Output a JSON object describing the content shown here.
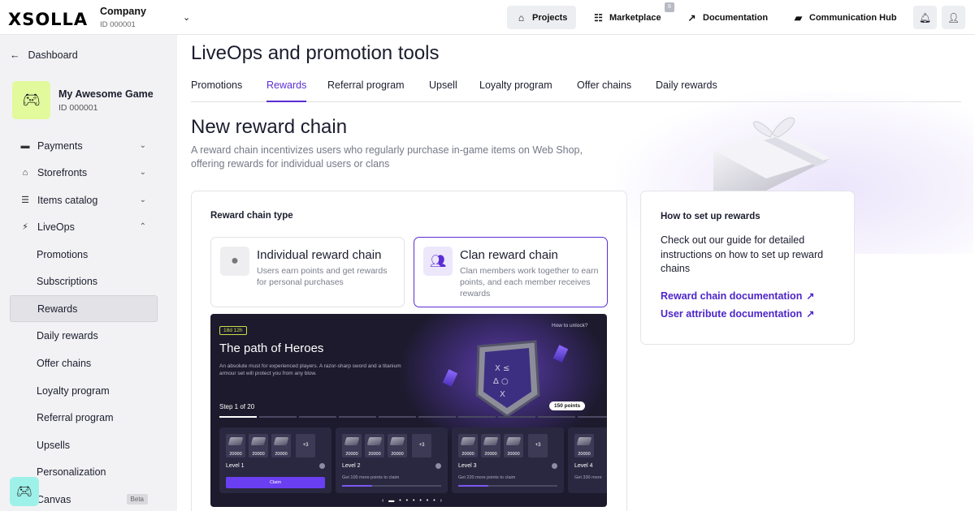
{
  "topbar": {
    "logo": "XSOLLA",
    "company_name": "Company",
    "company_id": "ID 000001",
    "nav": {
      "projects": "Projects",
      "marketplace": "Marketplace",
      "marketplace_badge": "8",
      "documentation": "Documentation",
      "communication_hub": "Communication Hub"
    }
  },
  "sidebar": {
    "back_label": "Dashboard",
    "game_name": "My Awesome Game",
    "game_id": "ID 000001",
    "groups": {
      "payments": "Payments",
      "storefronts": "Storefronts",
      "items_catalog": "Items catalog",
      "liveops": "LiveOps"
    },
    "liveops_items": {
      "promotions": "Promotions",
      "subscriptions": "Subscriptions",
      "rewards": "Rewards",
      "daily_rewards": "Daily rewards",
      "offer_chains": "Offer chains",
      "loyalty_program": "Loyalty program",
      "referral_program": "Referral program",
      "upsells": "Upsells",
      "personalization": "Personalization",
      "canvas": "Canvas"
    },
    "canvas_badge": "Beta",
    "active_item": "Rewards"
  },
  "main": {
    "page_title": "LiveOps and promotion tools",
    "tabs": {
      "promotions": "Promotions",
      "rewards": "Rewards",
      "referral_program": "Referral program",
      "upsell": "Upsell",
      "loyalty_program": "Loyalty program",
      "offer_chains": "Offer chains",
      "daily_rewards": "Daily rewards"
    },
    "active_tab": "Rewards",
    "section_title": "New reward chain",
    "section_desc": "A reward chain incentivizes users who regularly purchase in-game items on Web Shop, offering rewards for individual users or clans",
    "chain_type_label": "Reward chain type",
    "options": {
      "individual": {
        "title": "Individual reward chain",
        "desc": "Users earn points and get rewards for personal purchases"
      },
      "clan": {
        "title": "Clan reward chain",
        "desc": "Clan members work together to earn points, and each member receives rewards"
      }
    },
    "selected_option": "clan",
    "preview": {
      "timer": "18d 12h",
      "how_to_unlock": "How to unlock?",
      "title": "The path of Heroes",
      "desc": "An absolute must for experienced players. A razor-sharp sword and a titanium armour set will protect you from any blow.",
      "step": "Step 1 of 20",
      "points": "150 points",
      "levels": {
        "l1": {
          "name": "Level 1",
          "values": [
            "20000",
            "20000",
            "20000"
          ],
          "more": "+3",
          "claim": "Claim"
        },
        "l2": {
          "name": "Level 2",
          "values": [
            "20000",
            "20000",
            "20000"
          ],
          "more": "+3",
          "note": "Get 100 more points to claim",
          "progress": 0.3
        },
        "l3": {
          "name": "Level 3",
          "values": [
            "20000",
            "20000",
            "20000"
          ],
          "more": "+3",
          "note": "Get 220 more points to claim",
          "progress": 0.3
        },
        "l4": {
          "name": "Level 4",
          "values": [
            "20000"
          ],
          "note": "Get 330 more"
        }
      }
    },
    "help": {
      "title": "How to set up rewards",
      "desc": "Check out our guide for detailed instructions on how to set up reward chains",
      "link1": "Reward chain documentation",
      "link2": "User attribute documentation"
    }
  },
  "colors": {
    "accent": "#5b2ed4",
    "link": "#4d25c9",
    "game_tile": "#e2f99c",
    "helper": "#9ef1e8",
    "preview_bg": "#1c1a2c"
  }
}
